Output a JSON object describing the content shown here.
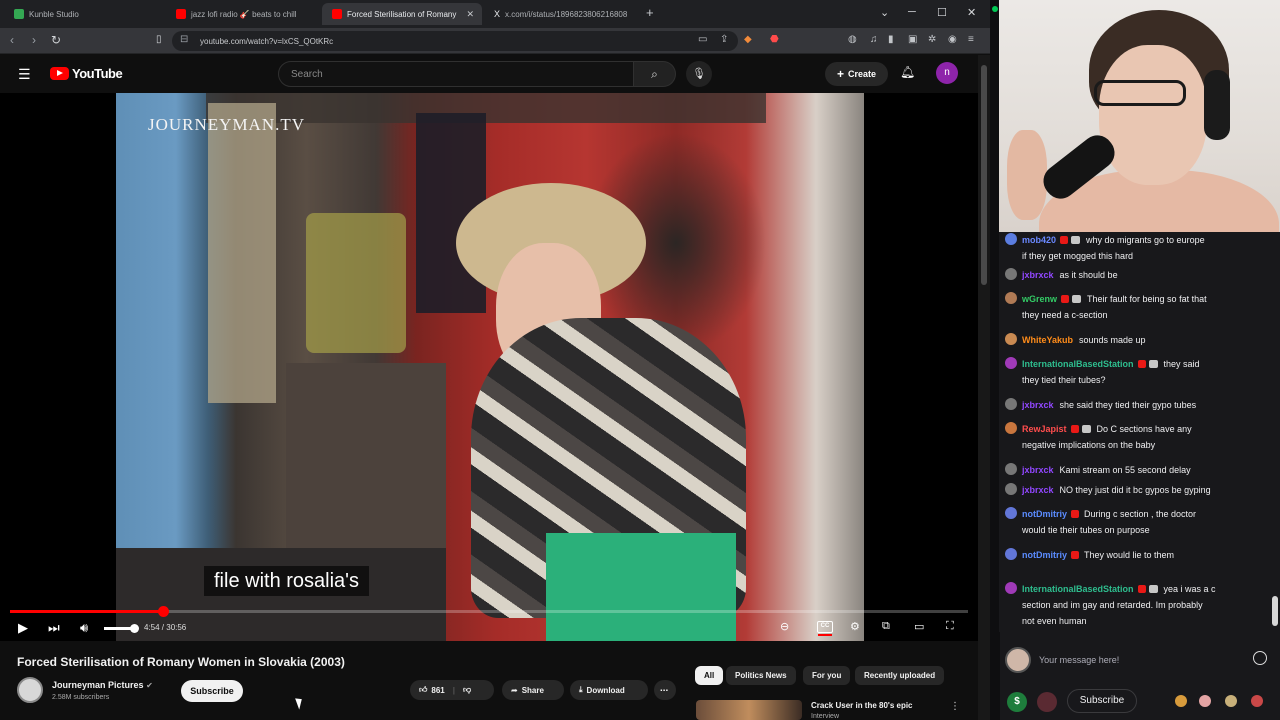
{
  "browser": {
    "tabs": [
      {
        "label": "Kunble Studio",
        "fav_color": "#34a853"
      },
      {
        "label": "jazz lofi radio 🎸 beats to chill",
        "fav_color": "#ff0000"
      },
      {
        "label": "Forced Sterilisation of Romany",
        "fav_color": "#ff0000"
      },
      {
        "label": "x.com/i/status/1896823806216808",
        "fav_color": "#e8eaed"
      }
    ],
    "url": "youtube.com/watch?v=lxCS_QOtKRc",
    "new_tab": "+",
    "win_min": "⌄",
    "win_minimize": "─",
    "win_max": "☐",
    "win_close": "✕"
  },
  "youtube": {
    "logo": "YouTube",
    "search_placeholder": "Search",
    "create_label": "Create",
    "avatar_letter": "n",
    "video": {
      "watermark": "JOURNEYMAN.TV",
      "caption": "file with rosalia's",
      "time": "4:54 / 30:56",
      "progress": 0.16
    },
    "title": "Forced Sterilisation of Romany Women in Slovakia (2003)",
    "channel": {
      "name": "Journeyman Pictures",
      "subs": "2.58M subscribers"
    },
    "subscribe_label": "Subscribe",
    "likes": "861",
    "share_label": "Share",
    "download_label": "Download",
    "chips": [
      "All",
      "Politics News",
      "For you",
      "Recently uploaded"
    ],
    "rec": {
      "title": "Crack User in the 80's epic",
      "sub": "Interview"
    }
  },
  "chat": {
    "messages": [
      {
        "user": "mob420",
        "color": "#6a88ff",
        "avatar": "#5b7de0",
        "badges": 2,
        "line1": "why do migrants go to europe",
        "line2": "if they get mogged this hard"
      },
      {
        "user": "jxbrxck",
        "color": "#9147ff",
        "avatar": "#777",
        "badges": 0,
        "line1": "as it should be",
        "line2": ""
      },
      {
        "user": "wGrenw",
        "color": "#33cc66",
        "avatar": "#b07a55",
        "badges": 2,
        "line1": "Their fault for being so fat that",
        "line2": "they need a c-section"
      },
      {
        "user": "WhiteYakub",
        "color": "#ff8c1a",
        "avatar": "#c98a52",
        "badges": 0,
        "line1": "sounds made up",
        "line2": ""
      },
      {
        "user": "InternationalBasedStation",
        "color": "#2ebd8e",
        "avatar": "#a03ab8",
        "badges": 2,
        "line1": "they said",
        "line2": "they tied their tubes?"
      },
      {
        "user": "jxbrxck",
        "color": "#9147ff",
        "avatar": "#777",
        "badges": 0,
        "line1": "she said they tied their gypo tubes",
        "line2": ""
      },
      {
        "user": "RewJapist",
        "color": "#ff4d4d",
        "avatar": "#c9763e",
        "badges": 2,
        "line1": "Do C sections have any",
        "line2": "negative implications on the baby"
      },
      {
        "user": "jxbrxck",
        "color": "#9147ff",
        "avatar": "#777",
        "badges": 0,
        "line1": "Kami stream on 55 second delay",
        "line2": ""
      },
      {
        "user": "jxbrxck",
        "color": "#9147ff",
        "avatar": "#777",
        "badges": 0,
        "line1": "NO they just did it bc gypos be gyping",
        "line2": ""
      },
      {
        "user": "notDmitriy",
        "color": "#5b8cff",
        "avatar": "#6276d8",
        "badges": 1,
        "line1": "During c section , the doctor",
        "line2": "would tie their tubes on purpose"
      },
      {
        "user": "notDmitriy",
        "color": "#5b8cff",
        "avatar": "#6276d8",
        "badges": 1,
        "line1": "They would lie to them",
        "line2": ""
      },
      {
        "user": "InternationalBasedStation",
        "color": "#2ebd8e",
        "avatar": "#a03ab8",
        "badges": 2,
        "line1": "yea i was a c",
        "line2": "section and im gay and retarded. Im probably",
        "line3": "not even human"
      }
    ],
    "input_placeholder": "Your message here!",
    "subscribe_label": "Subscribe",
    "dollar": "$"
  }
}
